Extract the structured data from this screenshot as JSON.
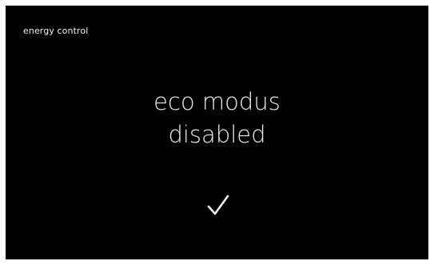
{
  "header": {
    "title": "energy control"
  },
  "message": {
    "line1": "eco modus",
    "line2": "disabled"
  },
  "icons": {
    "confirm": "check-icon"
  },
  "colors": {
    "background": "#000000",
    "text": "#ffffff"
  }
}
